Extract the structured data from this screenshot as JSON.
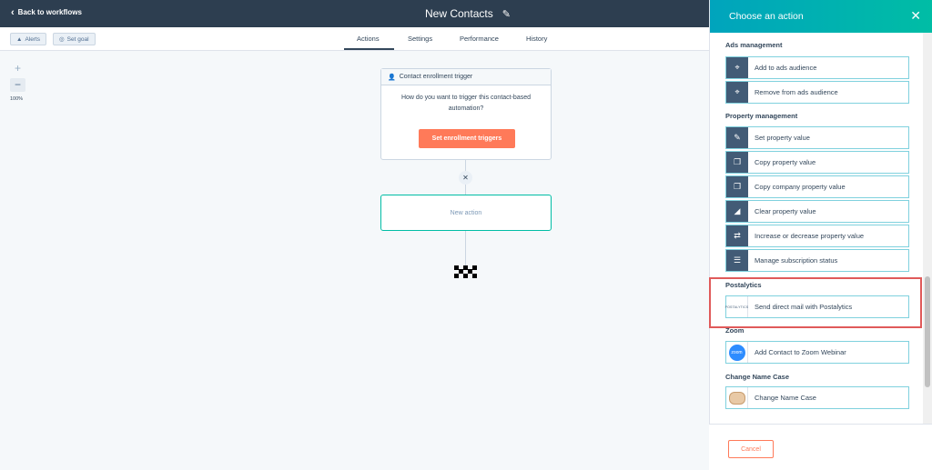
{
  "header": {
    "back_label": "Back to workflows",
    "title": "New Contacts"
  },
  "toolbar": {
    "alerts_label": "Alerts",
    "set_goal_label": "Set goal"
  },
  "tabs": [
    {
      "label": "Actions",
      "active": true
    },
    {
      "label": "Settings",
      "active": false
    },
    {
      "label": "Performance",
      "active": false
    },
    {
      "label": "History",
      "active": false
    }
  ],
  "zoom": {
    "plus": "+",
    "minus": "−",
    "level": "100%"
  },
  "canvas": {
    "trigger_title": "Contact enrollment trigger",
    "trigger_question": "How do you want to trigger this contact-based automation?",
    "trigger_button": "Set enrollment triggers",
    "new_action_label": "New action"
  },
  "panel": {
    "title": "Choose an action",
    "sections": [
      {
        "title": "Ads management",
        "items": [
          "Add to ads audience",
          "Remove from ads audience"
        ]
      },
      {
        "title": "Property management",
        "items": [
          "Set property value",
          "Copy property value",
          "Copy company property value",
          "Clear property value",
          "Increase or decrease property value",
          "Manage subscription status"
        ]
      },
      {
        "title": "Postalytics",
        "items": [
          "Send direct mail with Postalytics"
        ]
      },
      {
        "title": "Zoom",
        "items": [
          "Add Contact to Zoom Webinar"
        ]
      },
      {
        "title": "Change Name Case",
        "items": [
          "Change Name Case"
        ]
      }
    ],
    "postalytics_logo_text": "POSTALYTICS",
    "zoom_logo_text": "zoom",
    "cancel_label": "Cancel"
  },
  "colors": {
    "accent": "#00bda5",
    "primary_button": "#ff7a59",
    "topbar": "#2d3e50",
    "highlight": "#e05a5a"
  }
}
